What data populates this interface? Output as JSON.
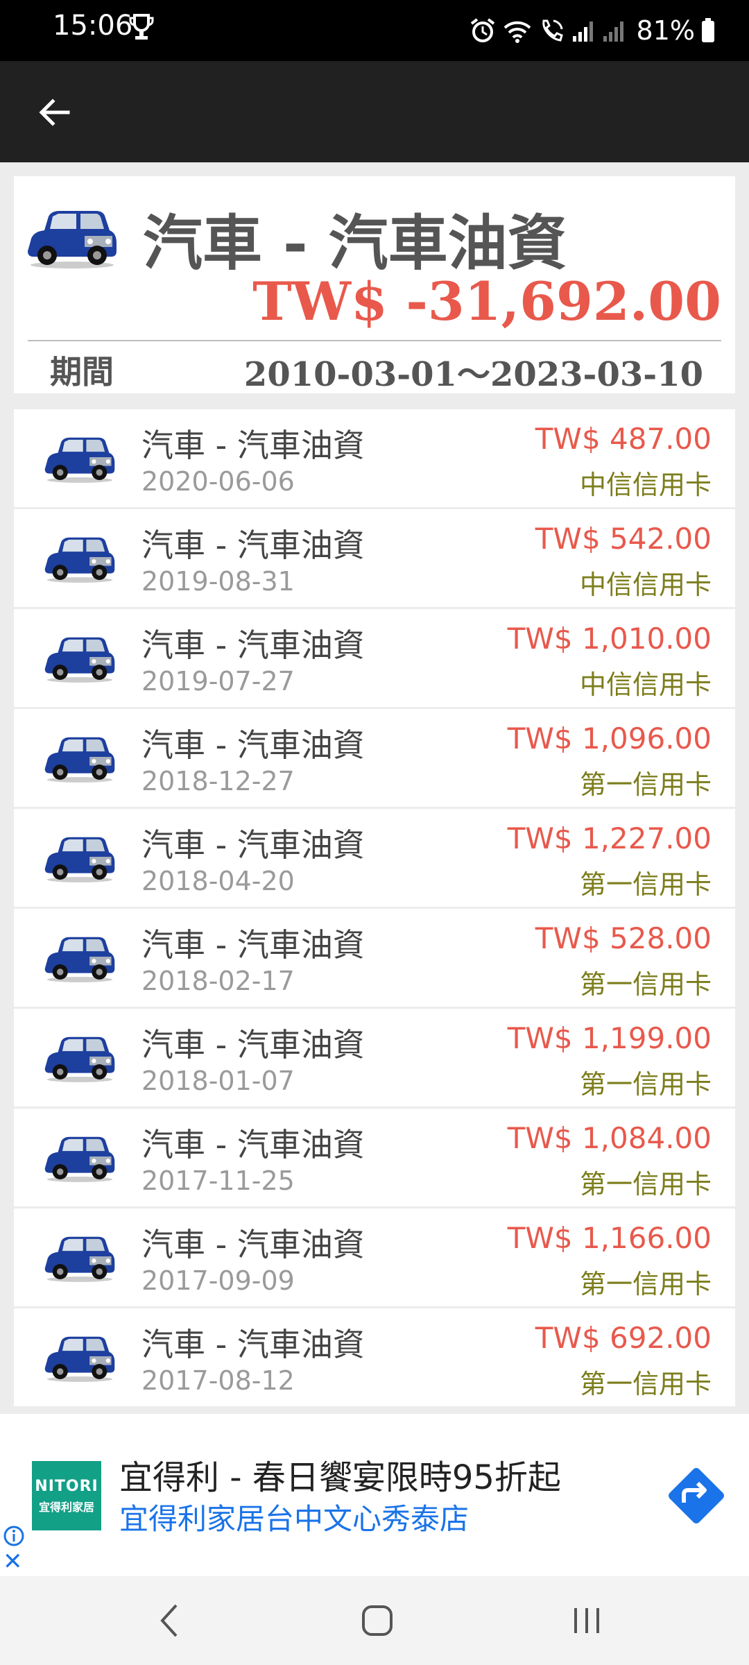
{
  "status_bar": {
    "time": "15:06",
    "battery": "81%"
  },
  "app_bar": {
    "back_icon": "arrow-left-icon"
  },
  "summary": {
    "title": "汽車 - 汽車油資",
    "total": "TW$ -31,692.00",
    "period_label": "期間",
    "period_range": "2010-03-01～2023-03-10"
  },
  "transactions": [
    {
      "title": "汽車 - 汽車油資",
      "date": "2020-06-06",
      "amount": "TW$ 487.00",
      "account": "中信信用卡"
    },
    {
      "title": "汽車 - 汽車油資",
      "date": "2019-08-31",
      "amount": "TW$ 542.00",
      "account": "中信信用卡"
    },
    {
      "title": "汽車 - 汽車油資",
      "date": "2019-07-27",
      "amount": "TW$ 1,010.00",
      "account": "中信信用卡"
    },
    {
      "title": "汽車 - 汽車油資",
      "date": "2018-12-27",
      "amount": "TW$ 1,096.00",
      "account": "第一信用卡"
    },
    {
      "title": "汽車 - 汽車油資",
      "date": "2018-04-20",
      "amount": "TW$ 1,227.00",
      "account": "第一信用卡"
    },
    {
      "title": "汽車 - 汽車油資",
      "date": "2018-02-17",
      "amount": "TW$ 528.00",
      "account": "第一信用卡"
    },
    {
      "title": "汽車 - 汽車油資",
      "date": "2018-01-07",
      "amount": "TW$ 1,199.00",
      "account": "第一信用卡"
    },
    {
      "title": "汽車 - 汽車油資",
      "date": "2017-11-25",
      "amount": "TW$ 1,084.00",
      "account": "第一信用卡"
    },
    {
      "title": "汽車 - 汽車油資",
      "date": "2017-09-09",
      "amount": "TW$ 1,166.00",
      "account": "第一信用卡"
    },
    {
      "title": "汽車 - 汽車油資",
      "date": "2017-08-12",
      "amount": "TW$ 692.00",
      "account": "第一信用卡"
    }
  ],
  "ad": {
    "logo_brand": "NITORI",
    "logo_sub": "宜得利家居",
    "title": "宜得利 - 春日饗宴限時95折起",
    "subtitle": "宜得利家居台中文心秀泰店"
  },
  "colors": {
    "expense": "#e8594c",
    "account": "#7c7d1c",
    "app_bar": "#212121",
    "ad_link": "#1a73e8"
  }
}
